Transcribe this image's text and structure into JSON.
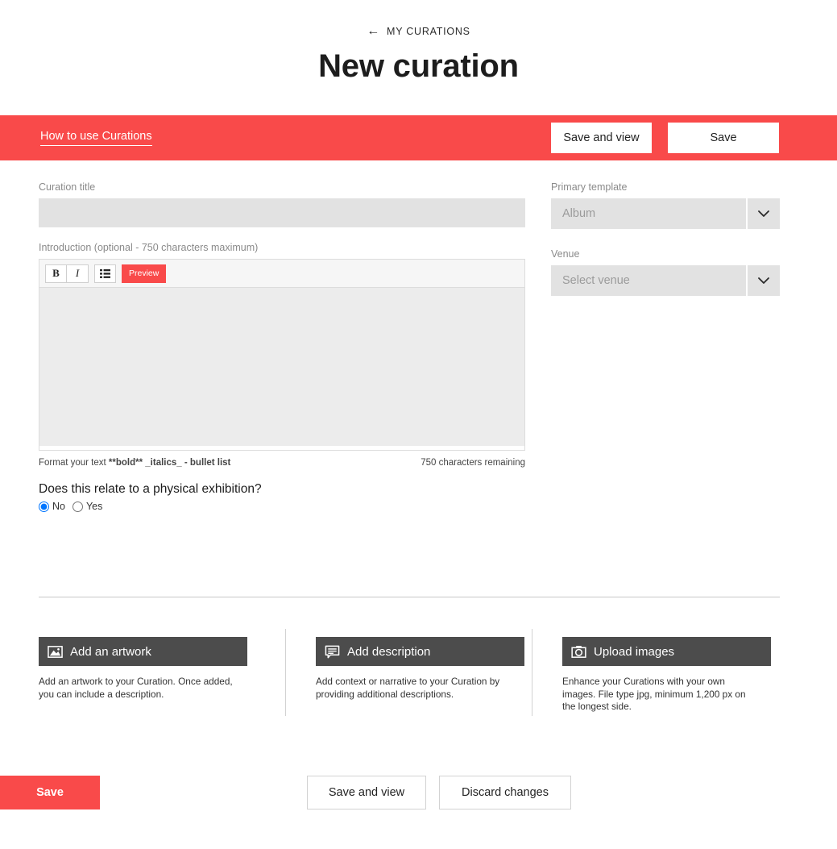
{
  "header": {
    "back_label": "MY CURATIONS",
    "back_icon": "arrow-left-icon",
    "title": "New curation"
  },
  "action_bar": {
    "help_link": "How to use Curations",
    "save_and_view": "Save and view",
    "save": "Save",
    "background_color": "#f94a4a"
  },
  "form": {
    "curation_title": {
      "label": "Curation title",
      "value": "",
      "placeholder": ""
    },
    "introduction": {
      "label": "Introduction (optional - 750 characters maximum)",
      "value": "",
      "placeholder": "",
      "toolbar": {
        "bold": "B",
        "italic": "I",
        "bullet_list": "☰",
        "preview": "Preview"
      },
      "format_hint_prefix": "Format your text ",
      "format_hint_bold": "**bold** _italics_ - bullet list",
      "characters_remaining": "750 characters remaining"
    },
    "exhibition_question": {
      "label": "Does this relate to a physical exhibition?",
      "options": [
        {
          "label": "No",
          "selected": true
        },
        {
          "label": "Yes",
          "selected": false
        }
      ]
    },
    "primary_template": {
      "label": "Primary template",
      "value": "Album",
      "caret_icon": "chevron-down-icon"
    },
    "venue": {
      "label": "Venue",
      "value": "Select venue",
      "caret_icon": "chevron-down-icon"
    }
  },
  "cards": [
    {
      "button_label": "Add an artwork",
      "icon": "image-icon",
      "description": "Add an artwork to your Curation. Once added, you can include a description."
    },
    {
      "button_label": "Add description",
      "icon": "comment-lines-icon",
      "description": "Add context or narrative to your Curation by providing additional descriptions."
    },
    {
      "button_label": "Upload images",
      "icon": "camera-icon",
      "description": "Enhance your Curations with your own images. File type jpg, minimum 1,200 px on the longest side."
    }
  ],
  "footer": {
    "save_and_view": "Save and view",
    "discard_changes": "Discard changes",
    "save": "Save",
    "save_color": "#f94a4a"
  }
}
